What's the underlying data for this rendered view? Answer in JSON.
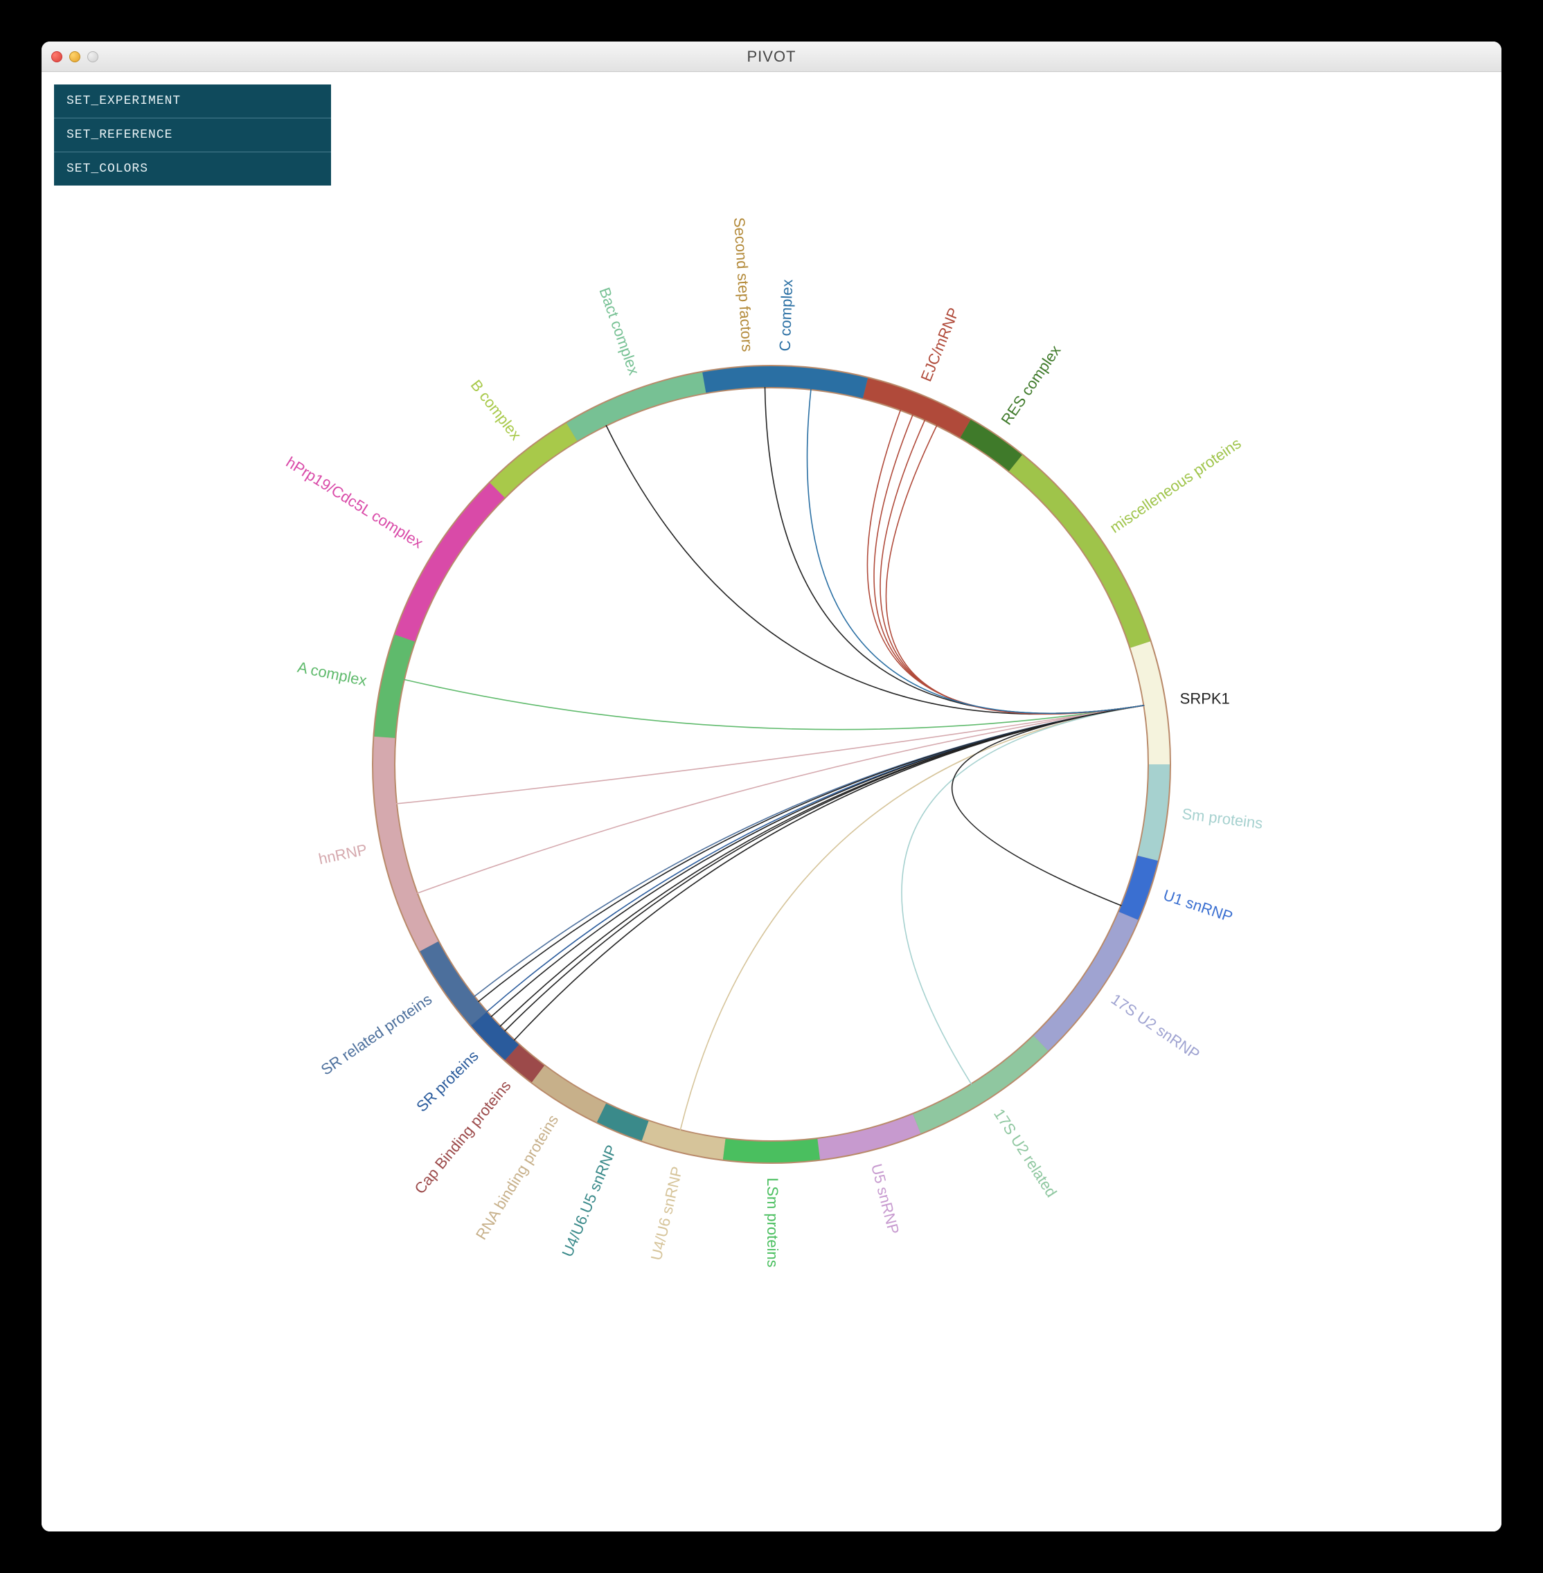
{
  "window": {
    "title": "PIVOT"
  },
  "menu": {
    "items": [
      {
        "label": "SET_EXPERIMENT"
      },
      {
        "label": "SET_REFERENCE"
      },
      {
        "label": "SET_COLORS"
      }
    ]
  },
  "chart_data": {
    "type": "chord",
    "center_label": "SRPK1",
    "center_angle": 9,
    "radius_inner": 545,
    "radius_outer": 575,
    "categories": [
      {
        "name": "Second step factors",
        "start": 89,
        "end": 98,
        "color": "#b38a3a"
      },
      {
        "name": "Bact complex",
        "start": 98,
        "end": 121,
        "color": "#77c194"
      },
      {
        "name": "B complex",
        "start": 121,
        "end": 135,
        "color": "#a8c94a"
      },
      {
        "name": "hPrp19/Cdc5L complex",
        "start": 135,
        "end": 161,
        "color": "#d94aa8"
      },
      {
        "name": "A complex",
        "start": 161,
        "end": 176,
        "color": "#5fba6c"
      },
      {
        "name": "hnRNP",
        "start": 176,
        "end": 208,
        "color": "#d5a9ae"
      },
      {
        "name": "SR related proteins",
        "start": 208,
        "end": 221,
        "color": "#4c6f9c"
      },
      {
        "name": "SR proteins",
        "start": 221,
        "end": 228,
        "color": "#2a5b9c"
      },
      {
        "name": "Cap Binding proteins",
        "start": 228,
        "end": 233,
        "color": "#9c4a4a"
      },
      {
        "name": "RNA binding proteins",
        "start": 233,
        "end": 244,
        "color": "#c7b08a"
      },
      {
        "name": "U4/U6.U5 snRNP",
        "start": 244,
        "end": 251,
        "color": "#3a8a8a"
      },
      {
        "name": "U4/U6 snRNP",
        "start": 251,
        "end": 263,
        "color": "#d6c49a"
      },
      {
        "name": "LSm proteins",
        "start": 263,
        "end": 277,
        "color": "#4abf5f"
      },
      {
        "name": "U5 snRNP",
        "start": 277,
        "end": 292,
        "color": "#c79acf"
      },
      {
        "name": "17S U2 related",
        "start": 292,
        "end": 314,
        "color": "#8fc7a0"
      },
      {
        "name": "17S U2 snRNP",
        "start": 314,
        "end": 337,
        "color": "#9fa3d1"
      },
      {
        "name": "U1 snRNP",
        "start": 337,
        "end": 346,
        "color": "#3a6fd1"
      },
      {
        "name": "Sm proteins",
        "start": 346,
        "end": 360,
        "color": "#a6d1cf"
      },
      {
        "name": "SRPK1",
        "start": 360,
        "end": 378,
        "color": "#f5f3dd"
      },
      {
        "name": "miscelleneous proteins",
        "start": 378,
        "end": 411,
        "color": "#9fc44a"
      },
      {
        "name": "RES complex",
        "start": 411,
        "end": 420,
        "color": "#3f7a2a"
      },
      {
        "name": "EJC/mRNP",
        "start": 420,
        "end": 436,
        "color": "#b04a3a"
      },
      {
        "name": "C complex",
        "start": 436,
        "end": 460,
        "color": "#2a6fa3"
      }
    ],
    "links": [
      {
        "to": 91,
        "color": "#222"
      },
      {
        "to": 116,
        "color": "#222"
      },
      {
        "to": 167,
        "color": "#5fba6c"
      },
      {
        "to": 186,
        "color": "#d5a9ae"
      },
      {
        "to": 200,
        "color": "#d5a9ae"
      },
      {
        "to": 218,
        "color": "#4c6f9c"
      },
      {
        "to": 219,
        "color": "#222"
      },
      {
        "to": 221,
        "color": "#2a5b9c"
      },
      {
        "to": 222,
        "color": "#222"
      },
      {
        "to": 224,
        "color": "#222"
      },
      {
        "to": 225,
        "color": "#222"
      },
      {
        "to": 227,
        "color": "#222"
      },
      {
        "to": 256,
        "color": "#d6c49a"
      },
      {
        "to": 302,
        "color": "#a6d1cf"
      },
      {
        "to": 338,
        "color": "#222"
      },
      {
        "to": 424,
        "color": "#b04a3a"
      },
      {
        "to": 426,
        "color": "#b04a3a"
      },
      {
        "to": 428,
        "color": "#b04a3a"
      },
      {
        "to": 430,
        "color": "#b04a3a"
      },
      {
        "to": 444,
        "color": "#2a6fa3"
      }
    ]
  }
}
